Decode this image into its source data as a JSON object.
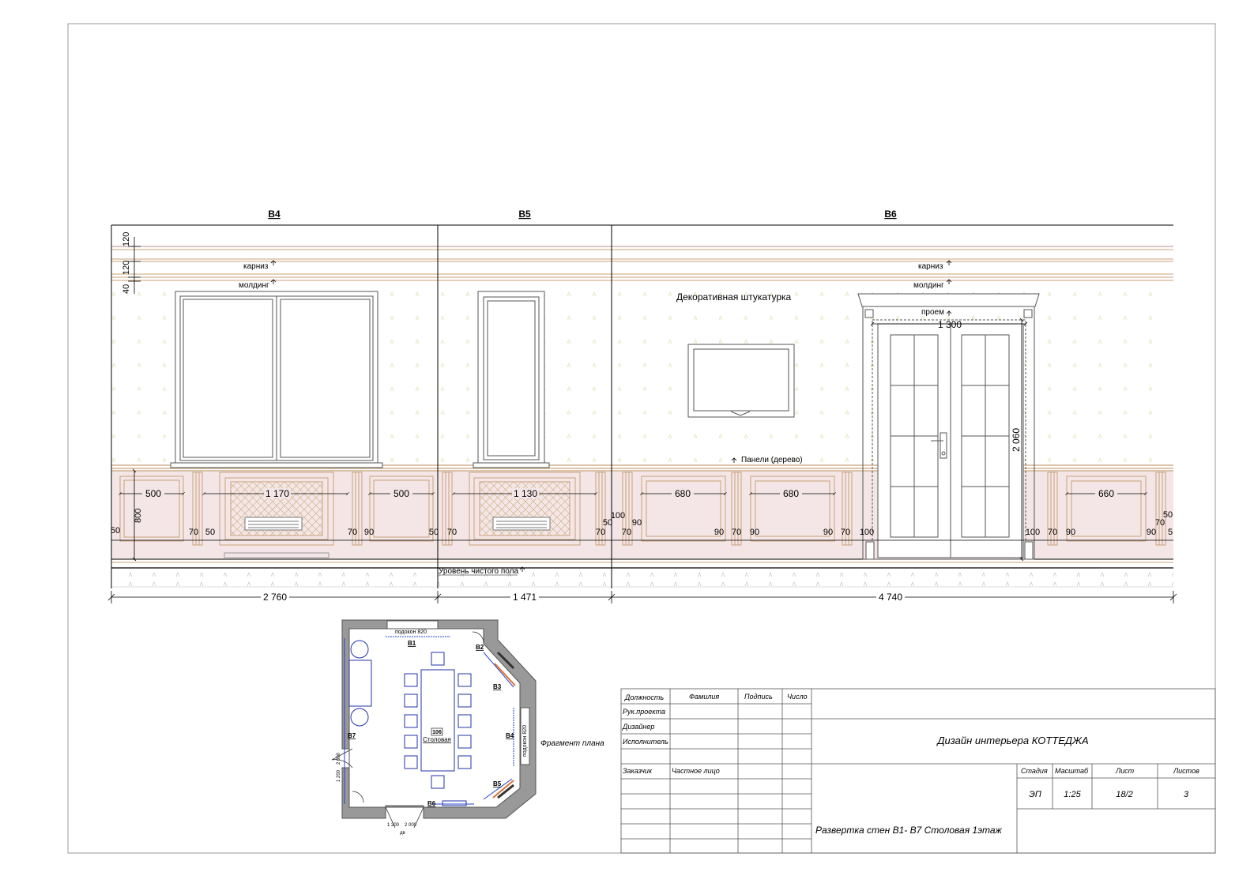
{
  "walls": [
    {
      "label": "В4",
      "width": "2 760"
    },
    {
      "label": "В5",
      "width": "1 471"
    },
    {
      "label": "В6",
      "width": "4 740"
    }
  ],
  "annotations": {
    "cornice_b4": "карниз",
    "molding_b4": "молдинг",
    "cornice_b6": "карниз",
    "molding_b6": "молдинг",
    "plaster": "Декоративная штукатурка",
    "opening": "проем",
    "panels": "Панели (дерево)",
    "floor": "Уровень чистого пола"
  },
  "heights": {
    "h120a": "120",
    "h120b": "120",
    "h40": "40",
    "h800": "800",
    "door_h": "2 060",
    "door_w": "1 300"
  },
  "dims_b4": {
    "p1": "500",
    "p2": "1 170",
    "p3": "500",
    "a": "50",
    "b": "70",
    "c": "50",
    "d": "70",
    "e": "90",
    "f": "50"
  },
  "dims_b5": {
    "p1": "1 130",
    "a": "70",
    "b": "70",
    "c": "50",
    "d": "100"
  },
  "dims_b6": {
    "p1": "680",
    "p2": "680",
    "p3": "660",
    "a": "70",
    "b": "90",
    "c": "90",
    "d": "70",
    "e": "90",
    "f": "90",
    "g": "70",
    "h": "100",
    "i": "100",
    "j": "70",
    "k": "90",
    "l": "90",
    "m": "70",
    "n": "50",
    "o": "5"
  },
  "plan": {
    "caption": "Фрагмент плана",
    "room_no": "106",
    "room_name": "Столовая",
    "sill_top": "подокон 820",
    "sill_right": "подокон 820",
    "door_dim1": "1 200",
    "door_dim2": "2 000",
    "door_dim3": "1 200",
    "door_dim4": "2 000",
    "door_tag": "дв",
    "tags": [
      "В1",
      "В2",
      "В3",
      "В4",
      "В5",
      "В6",
      "В7"
    ]
  },
  "title_block": {
    "col_position": "Должность",
    "col_surname": "Фамилия",
    "col_signature": "Подпись",
    "col_date": "Число",
    "role_1": "Рук.проекта",
    "role_2": "Дизайнер",
    "role_3": "Исполнитель",
    "client_label": "Заказчик",
    "client_value": "Частное лицо",
    "project_title": "Дизайн интерьера КОТТЕДЖА",
    "stage_label": "Стадия",
    "scale_label": "Масштаб",
    "sheet_label": "Лист",
    "sheets_label": "Листов",
    "stage": "ЭП",
    "scale": "1:25",
    "sheet": "18/2",
    "sheets": "3",
    "drawing_title": "Развертка стен В1- В7 Столовая 1этаж"
  }
}
